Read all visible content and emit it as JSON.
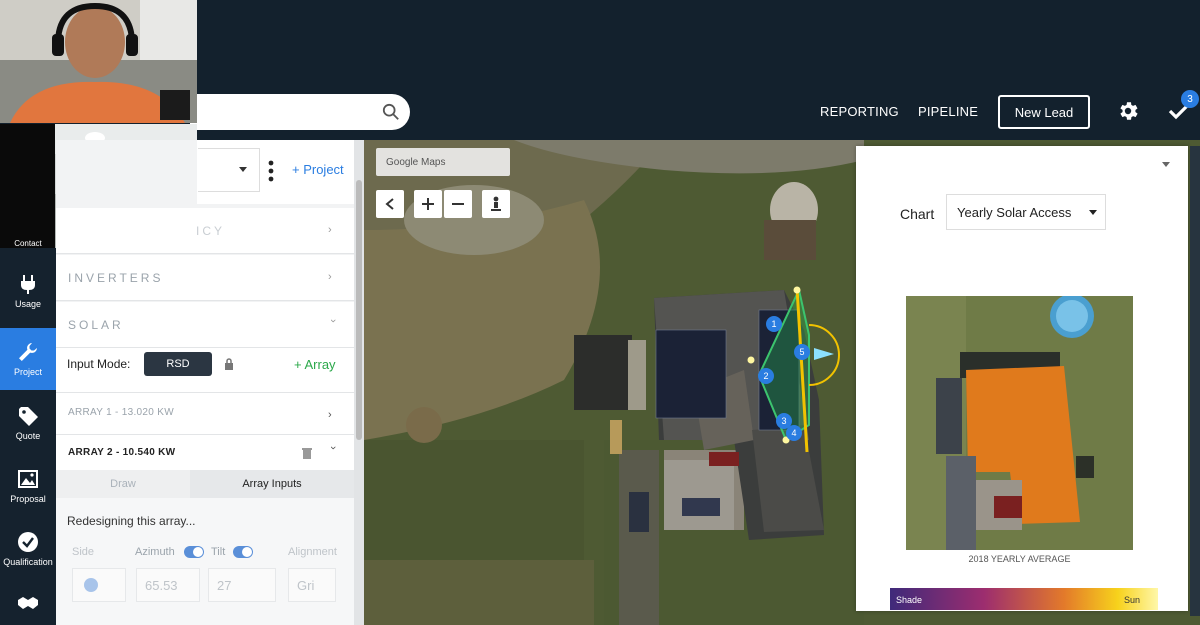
{
  "header": {
    "nav": [
      "REPORTING",
      "PIPELINE"
    ],
    "new_lead_label": "New Lead",
    "notification_count": "3"
  },
  "left_panel": {
    "add_project_label": "+ Project",
    "sections": {
      "efficiency_partial": "ICY",
      "inverters": "INVERTERS",
      "solar": "SOLAR"
    },
    "input_mode_label": "Input Mode:",
    "input_mode_value": "RSD",
    "add_array_label": "+ Array",
    "arrays": [
      {
        "label": "ARRAY 1 - 13.020 KW"
      },
      {
        "label": "ARRAY 2 - 10.540 KW"
      }
    ],
    "tabs": [
      "Draw",
      "Array Inputs"
    ],
    "redesign_text": "Redesigning this array...",
    "fields": {
      "side_label": "Side",
      "azimuth_label": "Azimuth",
      "tilt_label": "Tilt",
      "alignment_label": "Alignment",
      "azimuth_value": "65.53",
      "tilt_value": "27",
      "alignment_value": "Gri"
    }
  },
  "rail": [
    {
      "label": "Contact",
      "icon": "contact-icon"
    },
    {
      "label": "Usage",
      "icon": "plug-icon"
    },
    {
      "label": "Project",
      "icon": "wrench-icon",
      "active": true
    },
    {
      "label": "Quote",
      "icon": "tag-icon"
    },
    {
      "label": "Proposal",
      "icon": "image-icon"
    },
    {
      "label": "Qualification",
      "icon": "checkmark-circle-icon"
    },
    {
      "label": "Contracts",
      "icon": "handshake-icon"
    }
  ],
  "map": {
    "map_type": "Google Maps",
    "panel_markers": [
      "1",
      "2",
      "3",
      "4",
      "5"
    ]
  },
  "chart_panel": {
    "chart_label": "Chart",
    "chart_select_value": "Yearly Solar Access",
    "caption": "2018 YEARLY AVERAGE",
    "legend_min": "Shade",
    "legend_max": "Sun"
  },
  "colors": {
    "header_bg": "#13212d",
    "accent_blue": "#2a7de1",
    "accent_green": "#2ba84a",
    "rsd_bg": "#2b3642"
  }
}
